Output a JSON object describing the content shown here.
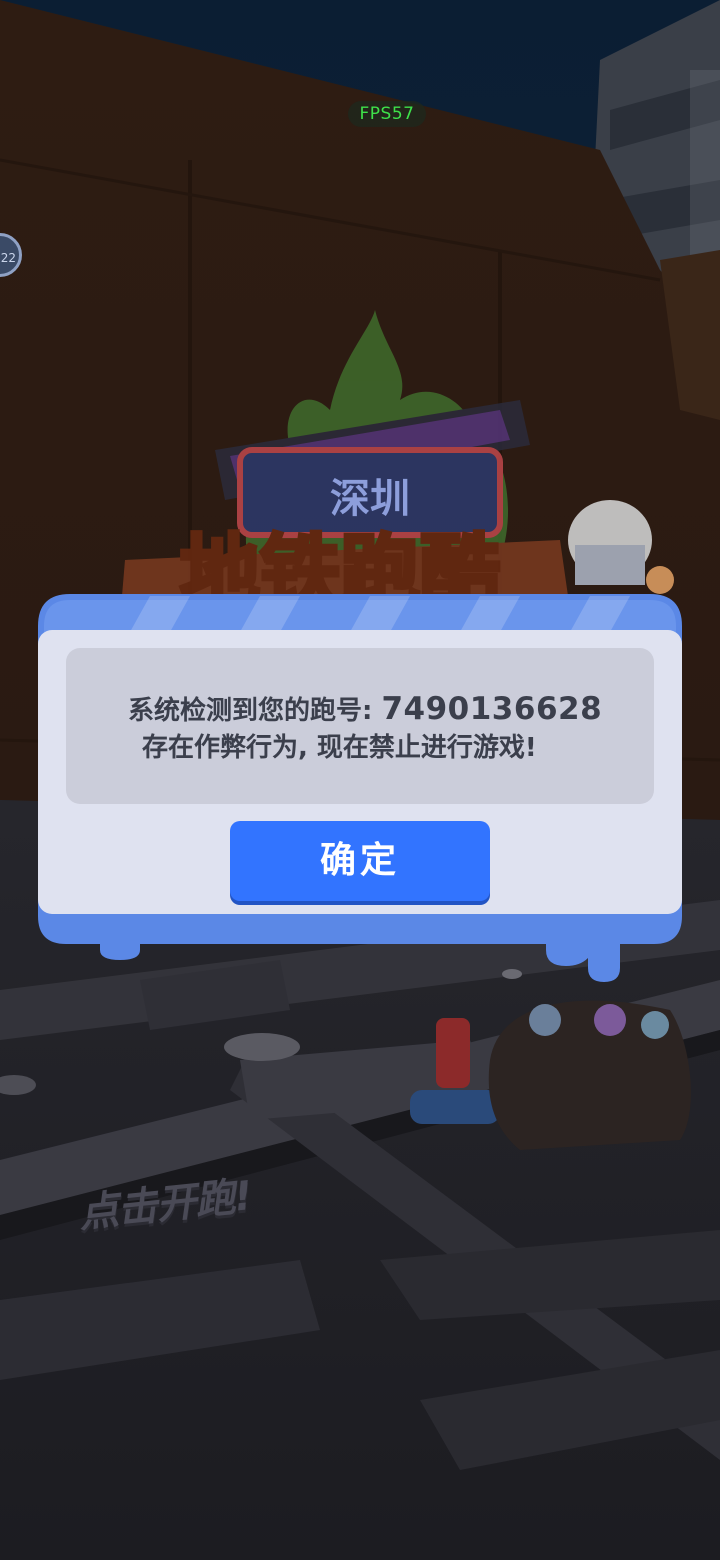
{
  "hud": {
    "fps_label": "FPS57",
    "side_badge": "22"
  },
  "game": {
    "tap_to_run": "点击开跑!"
  },
  "dialog": {
    "message_prefix": "系统检测到您的跑号: ",
    "account_id": "7490136628",
    "message_line2": "存在作弊行为, 现在禁止进行游戏!",
    "confirm_label": "确定"
  },
  "colors": {
    "dialog_blue": "#5b88e6",
    "dialog_body": "#dfe2f0",
    "message_panel": "#cbcdda",
    "button_blue": "#3274ff",
    "fps_green": "#3ee04a"
  },
  "icons": {
    "game_logo": "subway-runner-shenzhen-logo"
  }
}
